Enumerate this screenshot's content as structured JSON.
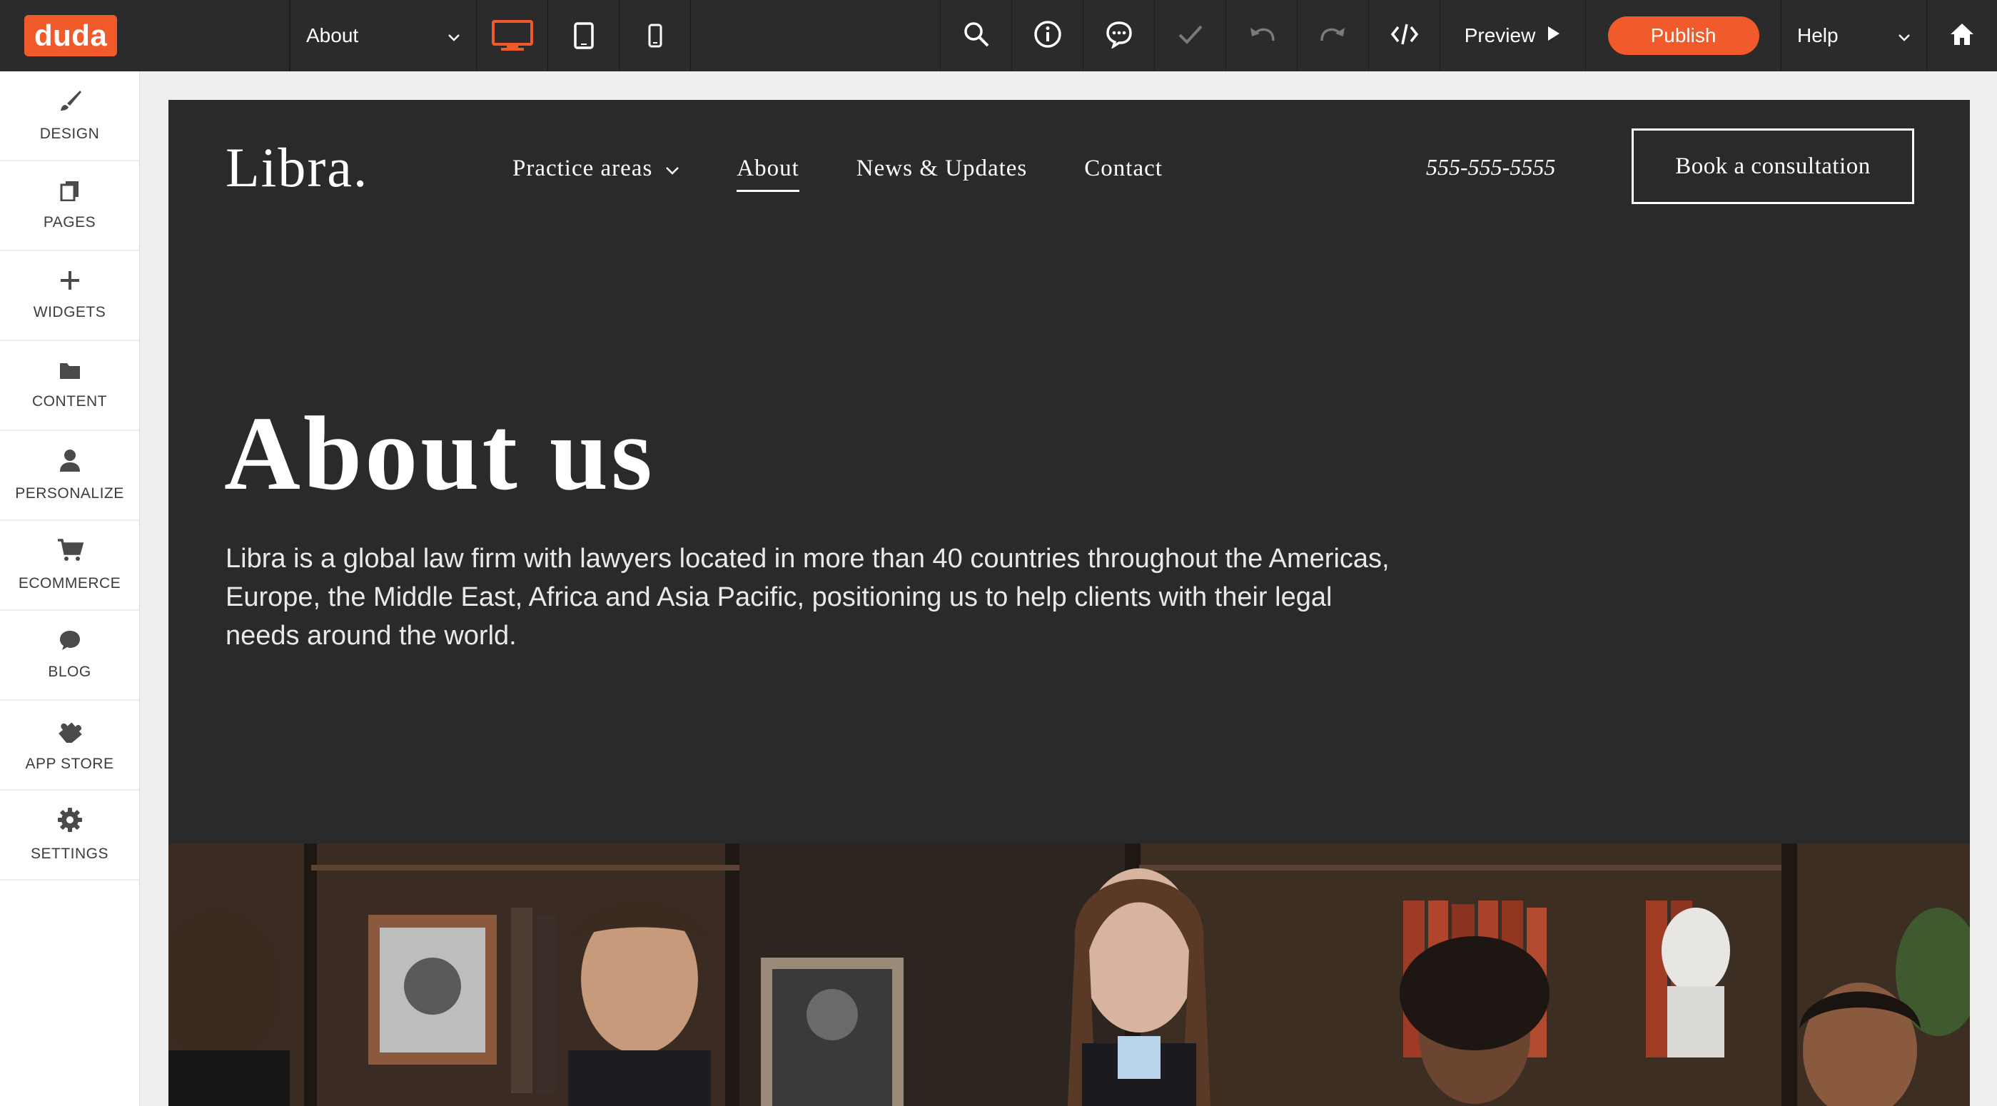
{
  "editor": {
    "logo": "duda",
    "page_selector": {
      "selected": "About"
    },
    "preview_label": "Preview",
    "publish_label": "Publish",
    "help_label": "Help",
    "devices": [
      "desktop-icon",
      "tablet-icon",
      "mobile-icon"
    ],
    "tools": [
      "search-icon",
      "info-icon",
      "comment-icon",
      "check-icon",
      "undo-icon",
      "redo-icon",
      "code-icon"
    ],
    "accent_color": "#f15a2b"
  },
  "sidebar": {
    "items": [
      {
        "label": "DESIGN",
        "icon": "brush-icon"
      },
      {
        "label": "PAGES",
        "icon": "pages-icon"
      },
      {
        "label": "WIDGETS",
        "icon": "plus-icon"
      },
      {
        "label": "CONTENT",
        "icon": "folder-icon"
      },
      {
        "label": "PERSONALIZE",
        "icon": "person-icon"
      },
      {
        "label": "ECOMMERCE",
        "icon": "cart-icon"
      },
      {
        "label": "BLOG",
        "icon": "chat-bubble-icon"
      },
      {
        "label": "APP STORE",
        "icon": "puzzle-icon"
      },
      {
        "label": "SETTINGS",
        "icon": "gear-icon"
      }
    ]
  },
  "site": {
    "logo": "Libra.",
    "nav": [
      {
        "label": "Practice areas",
        "has_dropdown": true,
        "active": false
      },
      {
        "label": "About",
        "has_dropdown": false,
        "active": true
      },
      {
        "label": "News & Updates",
        "has_dropdown": false,
        "active": false
      },
      {
        "label": "Contact",
        "has_dropdown": false,
        "active": false
      }
    ],
    "phone": "555-555-5555",
    "cta_label": "Book a consultation",
    "hero": {
      "title": "About us",
      "body": "Libra is a global law firm with lawyers located in more than 40 countries throughout the Americas, Europe, the Middle East, Africa and Asia Pacific, positioning us to help clients with their legal needs around the world."
    },
    "background_color": "#2b2a2b"
  }
}
